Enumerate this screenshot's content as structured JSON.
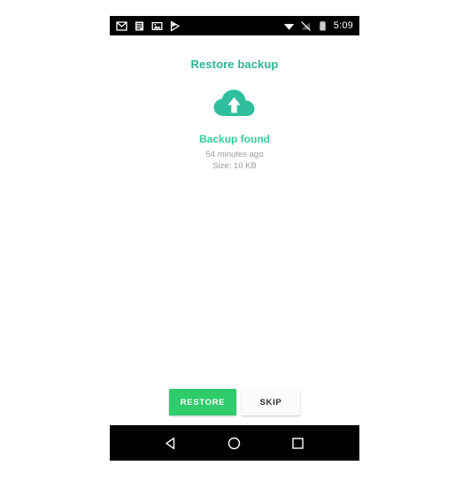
{
  "status_bar": {
    "left_icons": [
      {
        "name": "gmail-icon"
      },
      {
        "name": "list-document-icon"
      },
      {
        "name": "image-icon"
      },
      {
        "name": "play-store-icon"
      }
    ],
    "right_icons": [
      {
        "name": "wifi-icon"
      },
      {
        "name": "signal-off-icon"
      },
      {
        "name": "battery-icon"
      }
    ],
    "clock": "5:09"
  },
  "screen": {
    "title": "Restore backup",
    "cloud_icon": "cloud-upload-icon",
    "backup_status": "Backup found",
    "backup_time": "54 minutes ago",
    "backup_size": "Size: 10 KB"
  },
  "buttons": {
    "restore_label": "RESTORE",
    "skip_label": "SKIP"
  },
  "nav_bar": {
    "back": "back-triangle-icon",
    "home": "home-circle-icon",
    "recents": "recents-square-icon"
  },
  "colors": {
    "accent_teal": "#2eb398",
    "status_green": "#3ccb9a",
    "restore_green": "#2ecc6b",
    "meta_gray": "#9a9a9a",
    "bar_black": "#000000",
    "page_white": "#ffffff"
  }
}
